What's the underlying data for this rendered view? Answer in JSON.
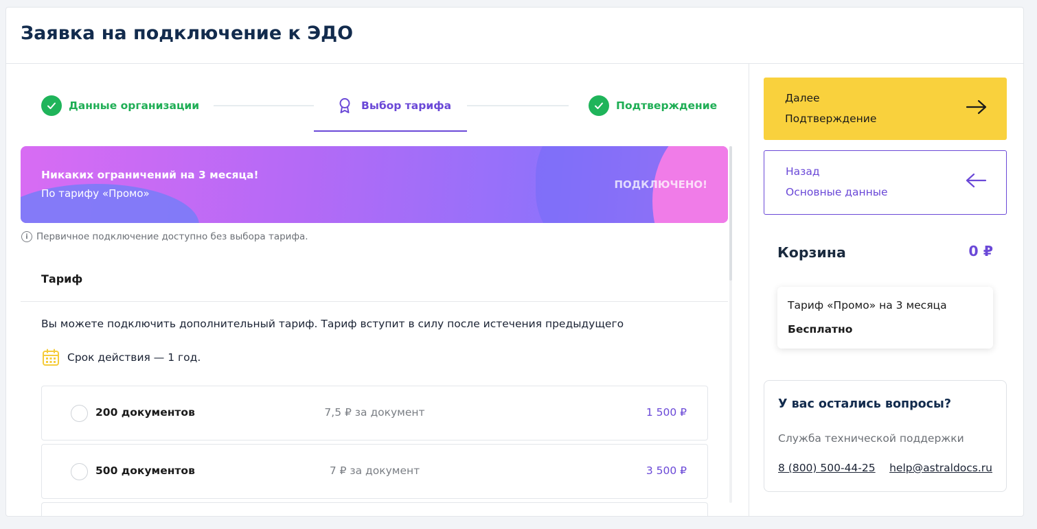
{
  "header": {
    "title": "Заявка на подключение к ЭДО"
  },
  "stepper": {
    "steps": [
      {
        "label": "Данные организации",
        "status": "done"
      },
      {
        "label": "Выбор тарифа",
        "status": "active"
      },
      {
        "label": "Подтверждение",
        "status": "done"
      }
    ]
  },
  "promo": {
    "title": "Никаких ограничений на 3 месяца!",
    "subtitle": "По тарифу «Промо»",
    "status": "ПОДКЛЮЧЕНО!"
  },
  "info_note": "Первичное подключение доступно без выбора тарифа.",
  "tariff_section": {
    "title": "Тариф",
    "description": "Вы можете подключить дополнительный тариф. Тариф вступит в силу после истечения предыдущего",
    "validity": "Срок действия — 1 год.",
    "options": [
      {
        "name": "200 документов",
        "per_doc": "7,5 ₽ за документ",
        "price": "1 500 ₽"
      },
      {
        "name": "500 документов",
        "per_doc": "7 ₽ за документ",
        "price": "3 500 ₽"
      }
    ]
  },
  "actions": {
    "next": {
      "line1": "Далее",
      "line2": "Подтверждение"
    },
    "back": {
      "line1": "Назад",
      "line2": "Основные данные"
    }
  },
  "cart": {
    "title": "Корзина",
    "total": "0 ₽",
    "items": [
      {
        "name": "Тариф «Промо» на 3 месяца",
        "price": "Бесплатно"
      }
    ]
  },
  "support": {
    "title": "У вас остались вопросы?",
    "subtitle": "Служба технической поддержки",
    "phone": "8 (800) 500-44-25",
    "email": "help@astraldocs.ru"
  },
  "colors": {
    "accent": "#6a48d7",
    "success": "#1fb45a",
    "primary_button": "#f9d13d",
    "title": "#122b4d"
  }
}
